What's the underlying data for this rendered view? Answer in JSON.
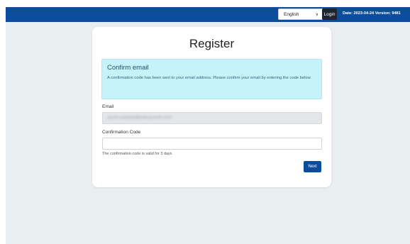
{
  "topbar": {
    "language_selected": "English",
    "login_label": "Login",
    "meta": "Date: 2023-04-24 Version: 9481"
  },
  "card": {
    "title": "Register",
    "alert": {
      "title": "Confirm email",
      "text": "A confirmation code has been sent to your email address. Please confirm your email by entering the code below"
    },
    "email_label": "Email",
    "email_value": "jacob.example@webclyourth.com",
    "code_label": "Confirmation Code",
    "code_value": "",
    "code_hint": "The confirmation code is valid for 3 days",
    "next_label": "Next"
  },
  "colors": {
    "brand": "#0b4c9c",
    "alert_bg": "#c6f2f9",
    "page_bg": "#e9eef1"
  },
  "icons": {
    "select_chevron": "chevron-down-icon"
  }
}
